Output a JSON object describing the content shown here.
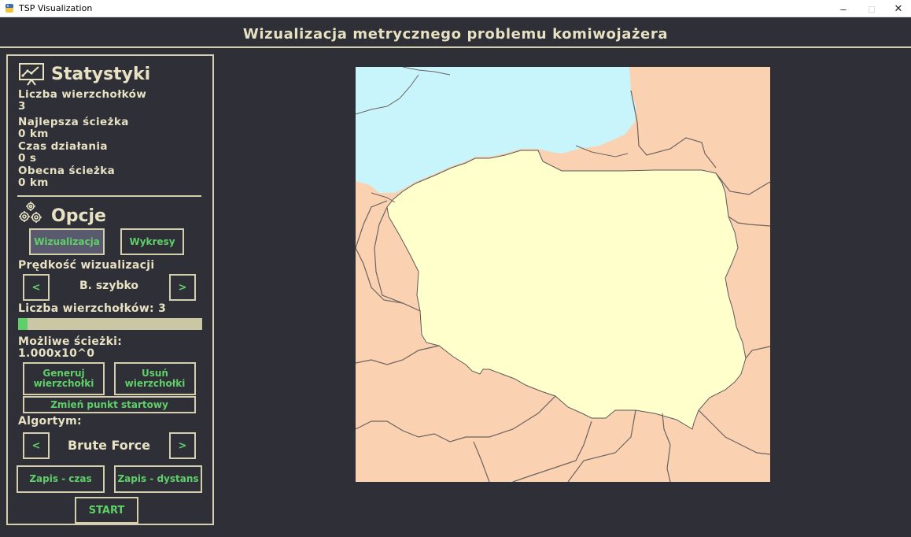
{
  "window": {
    "title": "TSP Visualization",
    "controls": {
      "minimize": "–",
      "maximize": "□",
      "close": "✕"
    }
  },
  "header": {
    "title": "Wizualizacja metrycznego problemu komiwojażera"
  },
  "stats": {
    "title": "Statystyki",
    "vertices_label": "Liczba wierzchołków",
    "vertices_value": "3",
    "best_path_label": "Najlepsza ścieżka",
    "best_path_value": "0 km",
    "runtime_label": "Czas działania",
    "runtime_value": "0 s",
    "current_path_label": "Obecna ścieżka",
    "current_path_value": "0 km"
  },
  "options": {
    "title": "Opcje",
    "tab_visualization": "Wizualizacja",
    "tab_charts": "Wykresy",
    "speed_label": "Prędkość wizualizacji",
    "speed_prev": "<",
    "speed_value": "B. szybko",
    "speed_next": ">",
    "vertex_count_label": "Liczba wierzchołków: 3",
    "vertex_slider_fraction": 0.05,
    "possible_paths_label": "Możliwe ścieżki:",
    "possible_paths_value": "1.000x10^0",
    "generate_button": "Generuj wierzchołki",
    "delete_button": "Usuń wierzchołki",
    "change_start_button": "Zmień punkt startowy",
    "algorithm_label": "Algortym:",
    "algorithm_prev": "<",
    "algorithm_value": "Brute Force",
    "algorithm_next": ">",
    "save_time_button": "Zapis - czas",
    "save_distance_button": "Zapis - dystans",
    "start_button": "START"
  },
  "colors": {
    "background": "#2f2f38",
    "accent_cream": "#e8e2c3",
    "accent_green": "#5fd068",
    "active_button": "#5a5a6e",
    "map_sea": "#c8f4fb",
    "map_poland": "#ffffcc",
    "map_neighbors": "#fad2b2"
  }
}
